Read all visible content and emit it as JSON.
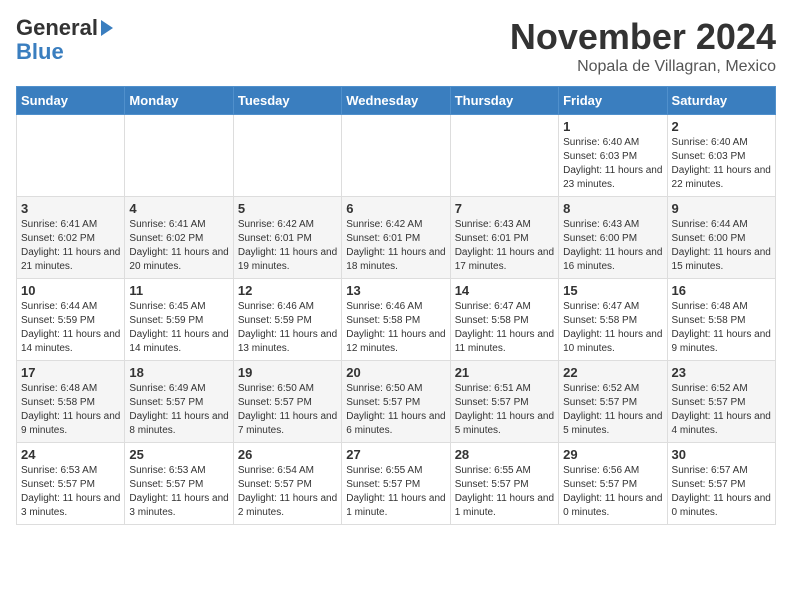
{
  "header": {
    "logo_general": "General",
    "logo_blue": "Blue",
    "month": "November 2024",
    "location": "Nopala de Villagran, Mexico"
  },
  "days_of_week": [
    "Sunday",
    "Monday",
    "Tuesday",
    "Wednesday",
    "Thursday",
    "Friday",
    "Saturday"
  ],
  "weeks": [
    [
      {
        "day": "",
        "info": ""
      },
      {
        "day": "",
        "info": ""
      },
      {
        "day": "",
        "info": ""
      },
      {
        "day": "",
        "info": ""
      },
      {
        "day": "",
        "info": ""
      },
      {
        "day": "1",
        "info": "Sunrise: 6:40 AM\nSunset: 6:03 PM\nDaylight: 11 hours and 23 minutes."
      },
      {
        "day": "2",
        "info": "Sunrise: 6:40 AM\nSunset: 6:03 PM\nDaylight: 11 hours and 22 minutes."
      }
    ],
    [
      {
        "day": "3",
        "info": "Sunrise: 6:41 AM\nSunset: 6:02 PM\nDaylight: 11 hours and 21 minutes."
      },
      {
        "day": "4",
        "info": "Sunrise: 6:41 AM\nSunset: 6:02 PM\nDaylight: 11 hours and 20 minutes."
      },
      {
        "day": "5",
        "info": "Sunrise: 6:42 AM\nSunset: 6:01 PM\nDaylight: 11 hours and 19 minutes."
      },
      {
        "day": "6",
        "info": "Sunrise: 6:42 AM\nSunset: 6:01 PM\nDaylight: 11 hours and 18 minutes."
      },
      {
        "day": "7",
        "info": "Sunrise: 6:43 AM\nSunset: 6:01 PM\nDaylight: 11 hours and 17 minutes."
      },
      {
        "day": "8",
        "info": "Sunrise: 6:43 AM\nSunset: 6:00 PM\nDaylight: 11 hours and 16 minutes."
      },
      {
        "day": "9",
        "info": "Sunrise: 6:44 AM\nSunset: 6:00 PM\nDaylight: 11 hours and 15 minutes."
      }
    ],
    [
      {
        "day": "10",
        "info": "Sunrise: 6:44 AM\nSunset: 5:59 PM\nDaylight: 11 hours and 14 minutes."
      },
      {
        "day": "11",
        "info": "Sunrise: 6:45 AM\nSunset: 5:59 PM\nDaylight: 11 hours and 14 minutes."
      },
      {
        "day": "12",
        "info": "Sunrise: 6:46 AM\nSunset: 5:59 PM\nDaylight: 11 hours and 13 minutes."
      },
      {
        "day": "13",
        "info": "Sunrise: 6:46 AM\nSunset: 5:58 PM\nDaylight: 11 hours and 12 minutes."
      },
      {
        "day": "14",
        "info": "Sunrise: 6:47 AM\nSunset: 5:58 PM\nDaylight: 11 hours and 11 minutes."
      },
      {
        "day": "15",
        "info": "Sunrise: 6:47 AM\nSunset: 5:58 PM\nDaylight: 11 hours and 10 minutes."
      },
      {
        "day": "16",
        "info": "Sunrise: 6:48 AM\nSunset: 5:58 PM\nDaylight: 11 hours and 9 minutes."
      }
    ],
    [
      {
        "day": "17",
        "info": "Sunrise: 6:48 AM\nSunset: 5:58 PM\nDaylight: 11 hours and 9 minutes."
      },
      {
        "day": "18",
        "info": "Sunrise: 6:49 AM\nSunset: 5:57 PM\nDaylight: 11 hours and 8 minutes."
      },
      {
        "day": "19",
        "info": "Sunrise: 6:50 AM\nSunset: 5:57 PM\nDaylight: 11 hours and 7 minutes."
      },
      {
        "day": "20",
        "info": "Sunrise: 6:50 AM\nSunset: 5:57 PM\nDaylight: 11 hours and 6 minutes."
      },
      {
        "day": "21",
        "info": "Sunrise: 6:51 AM\nSunset: 5:57 PM\nDaylight: 11 hours and 5 minutes."
      },
      {
        "day": "22",
        "info": "Sunrise: 6:52 AM\nSunset: 5:57 PM\nDaylight: 11 hours and 5 minutes."
      },
      {
        "day": "23",
        "info": "Sunrise: 6:52 AM\nSunset: 5:57 PM\nDaylight: 11 hours and 4 minutes."
      }
    ],
    [
      {
        "day": "24",
        "info": "Sunrise: 6:53 AM\nSunset: 5:57 PM\nDaylight: 11 hours and 3 minutes."
      },
      {
        "day": "25",
        "info": "Sunrise: 6:53 AM\nSunset: 5:57 PM\nDaylight: 11 hours and 3 minutes."
      },
      {
        "day": "26",
        "info": "Sunrise: 6:54 AM\nSunset: 5:57 PM\nDaylight: 11 hours and 2 minutes."
      },
      {
        "day": "27",
        "info": "Sunrise: 6:55 AM\nSunset: 5:57 PM\nDaylight: 11 hours and 1 minute."
      },
      {
        "day": "28",
        "info": "Sunrise: 6:55 AM\nSunset: 5:57 PM\nDaylight: 11 hours and 1 minute."
      },
      {
        "day": "29",
        "info": "Sunrise: 6:56 AM\nSunset: 5:57 PM\nDaylight: 11 hours and 0 minutes."
      },
      {
        "day": "30",
        "info": "Sunrise: 6:57 AM\nSunset: 5:57 PM\nDaylight: 11 hours and 0 minutes."
      }
    ]
  ]
}
